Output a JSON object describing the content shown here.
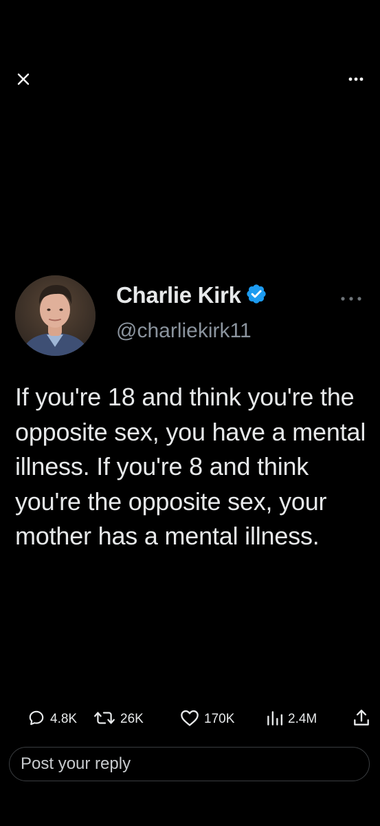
{
  "topbar": {
    "close_icon": "close-icon",
    "more_icon": "more-horizontal-icon"
  },
  "tweet": {
    "author_name": "Charlie Kirk",
    "author_handle": "@charliekirk11",
    "verified_icon": "verified-badge-icon",
    "more_icon": "more-horizontal-icon",
    "text": "If you're 18 and think you're the opposite sex, you have a mental illness. If you're 8 and think you're the opposite sex, your mother has a mental illness."
  },
  "actions": {
    "replies": "4.8K",
    "reposts": "26K",
    "likes": "170K",
    "views": "2.4M",
    "share_icon": "share-icon"
  },
  "reply_box": {
    "placeholder": "Post your reply"
  },
  "colors": {
    "background": "#000000",
    "text": "#e7e9ea",
    "handle": "#8b949e",
    "verified": "#1d9bf0"
  }
}
